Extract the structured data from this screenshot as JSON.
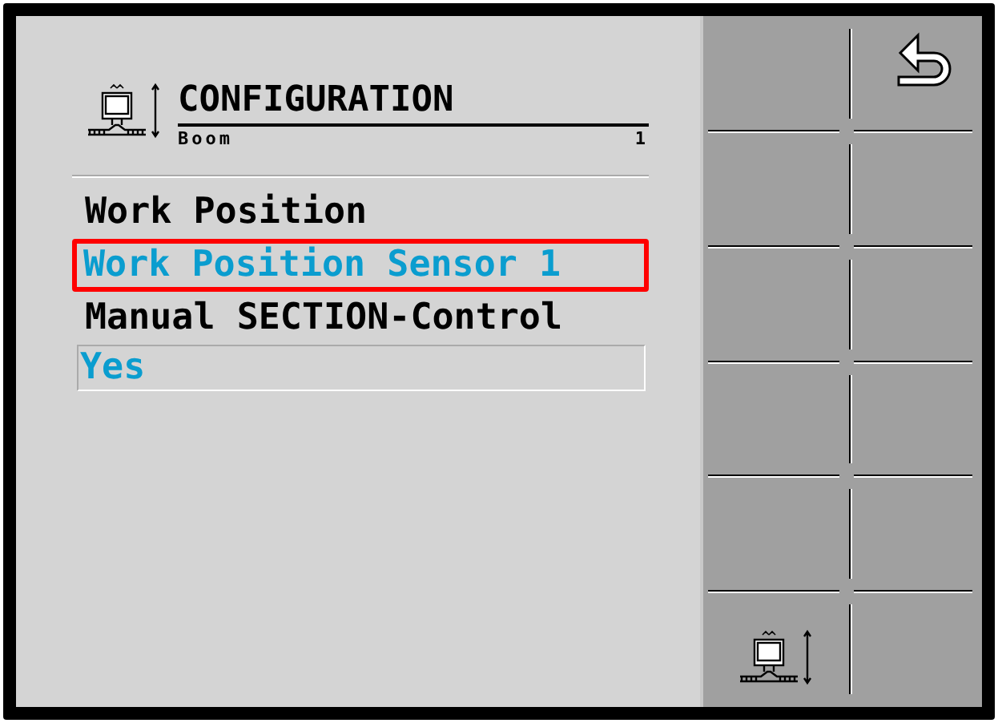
{
  "header": {
    "title": "CONFIGURATION",
    "subtitle": "Boom",
    "number": "1"
  },
  "items": [
    {
      "kind": "label",
      "text": "Work Position"
    },
    {
      "kind": "value",
      "text": "Work Position Sensor 1",
      "selected": true
    },
    {
      "kind": "label",
      "text": "Manual SECTION-Control"
    },
    {
      "kind": "value",
      "text": "Yes",
      "selected": false
    }
  ],
  "softkeys": [
    {
      "kind": "empty"
    },
    {
      "kind": "back"
    },
    {
      "kind": "empty"
    },
    {
      "kind": "empty"
    },
    {
      "kind": "empty"
    },
    {
      "kind": "empty"
    },
    {
      "kind": "empty"
    },
    {
      "kind": "empty"
    },
    {
      "kind": "empty"
    },
    {
      "kind": "empty"
    },
    {
      "kind": "boom"
    },
    {
      "kind": "empty"
    }
  ]
}
